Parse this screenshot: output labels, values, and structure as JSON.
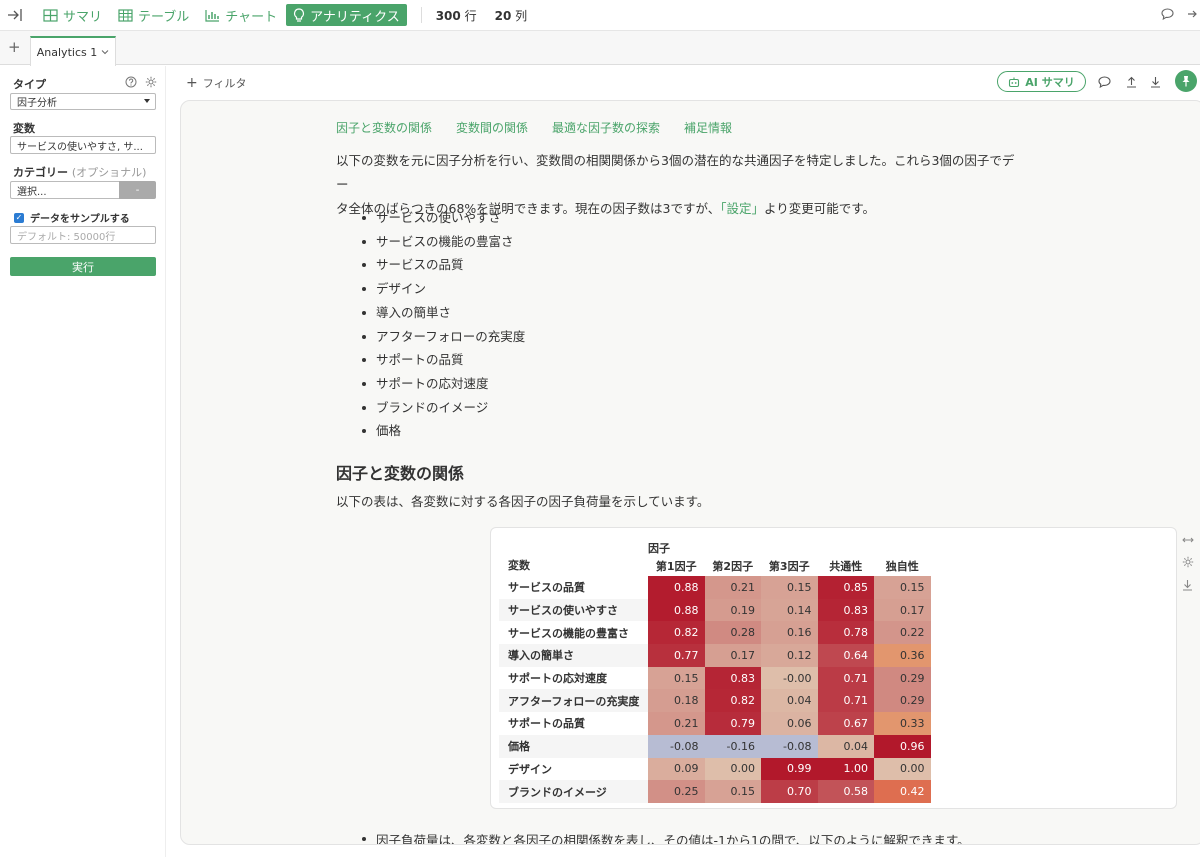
{
  "toolbar": {
    "views": [
      {
        "label": "サマリ",
        "icon": "summary-icon",
        "active": false
      },
      {
        "label": "テーブル",
        "icon": "table-icon",
        "active": false
      },
      {
        "label": "チャート",
        "icon": "chart-icon",
        "active": false
      },
      {
        "label": "アナリティクス",
        "icon": "lightbulb-icon",
        "active": true
      }
    ],
    "rows_count": "300",
    "rows_unit": "行",
    "cols_count": "20",
    "cols_unit": "列"
  },
  "tabs": [
    {
      "label": "Analytics 1"
    }
  ],
  "sidebar": {
    "type_label": "タイプ",
    "type_value": "因子分析",
    "variables_label": "変数",
    "variables_value": "サービスの使いやすさ, サ...",
    "category_label": "カテゴリー",
    "category_optional": "(オプショナル)",
    "category_placeholder": "選択...",
    "category_button": "-",
    "sample_label": "データをサンプルする",
    "sample_checked": true,
    "sample_placeholder": "デフォルト: 50000行",
    "run_label": "実行"
  },
  "header": {
    "filter_label": "フィルタ",
    "ai_summary_label": "AI サマリ"
  },
  "content": {
    "subnav": [
      "因子と変数の関係",
      "変数間の関係",
      "最適な因子数の探索",
      "補足情報"
    ],
    "intro_line1": "以下の変数を元に因子分析を行い、変数間の相関関係から3個の潜在的な共通因子を特定しました。これら3個の因子でデー",
    "intro_line2_pre": "タ全体のばらつきの68%を説明できます。現在の因子数は3ですが、",
    "intro_link": "「設定」",
    "intro_line2_post": "より変更可能です。",
    "variables": [
      "サービスの使いやすさ",
      "サービスの機能の豊富さ",
      "サービスの品質",
      "デザイン",
      "導入の簡単さ",
      "アフターフォローの充実度",
      "サポートの品質",
      "サポートの応対速度",
      "ブランドのイメージ",
      "価格"
    ],
    "section_title": "因子と変数の関係",
    "section_desc": "以下の表は、各変数に対する各因子の因子負荷量を示しています。",
    "table": {
      "group_header": "因子",
      "var_header": "変数",
      "columns": [
        "第1因子",
        "第2因子",
        "第3因子",
        "共通性",
        "独自性"
      ],
      "rows": [
        {
          "name": "サービスの品質",
          "values": [
            "0.88",
            "0.21",
            "0.15",
            "0.85",
            "0.15"
          ]
        },
        {
          "name": "サービスの使いやすさ",
          "values": [
            "0.88",
            "0.19",
            "0.14",
            "0.83",
            "0.17"
          ]
        },
        {
          "name": "サービスの機能の豊富さ",
          "values": [
            "0.82",
            "0.28",
            "0.16",
            "0.78",
            "0.22"
          ]
        },
        {
          "name": "導入の簡単さ",
          "values": [
            "0.77",
            "0.17",
            "0.12",
            "0.64",
            "0.36"
          ]
        },
        {
          "name": "サポートの応対速度",
          "values": [
            "0.15",
            "0.83",
            "-0.00",
            "0.71",
            "0.29"
          ]
        },
        {
          "name": "アフターフォローの充実度",
          "values": [
            "0.18",
            "0.82",
            "0.04",
            "0.71",
            "0.29"
          ]
        },
        {
          "name": "サポートの品質",
          "values": [
            "0.21",
            "0.79",
            "0.06",
            "0.67",
            "0.33"
          ]
        },
        {
          "name": "価格",
          "values": [
            "-0.08",
            "-0.16",
            "-0.08",
            "0.04",
            "0.96"
          ]
        },
        {
          "name": "デザイン",
          "values": [
            "0.09",
            "0.00",
            "0.99",
            "1.00",
            "0.00"
          ]
        },
        {
          "name": "ブランドのイメージ",
          "values": [
            "0.25",
            "0.15",
            "0.70",
            "0.58",
            "0.42"
          ]
        }
      ]
    },
    "note": "因子負荷量は、各変数と各因子の相関係数を表し、その値は-1から1の間で、以下のように解釈できます。"
  },
  "colors": {
    "accent": "#4aa46a",
    "high": "#b2182b",
    "low": "#b7bcd3"
  }
}
